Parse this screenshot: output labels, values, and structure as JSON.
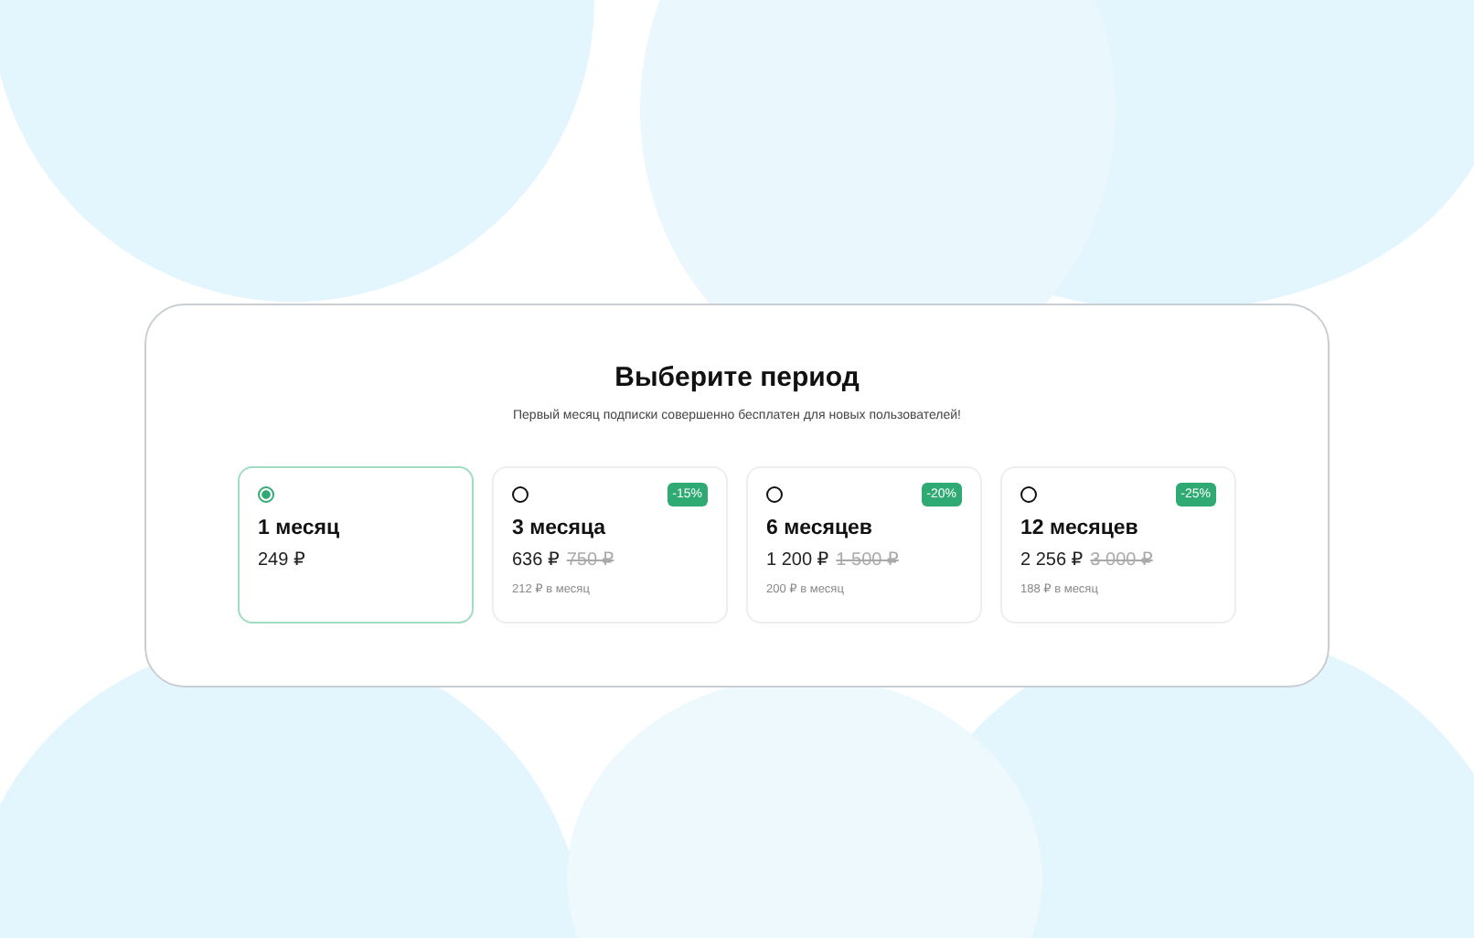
{
  "title": "Выберите период",
  "subtitle": "Первый месяц подписки совершенно бесплатен для новых пользователей!",
  "plans": [
    {
      "name": "1 месяц",
      "price": "249 ₽",
      "selected": true
    },
    {
      "name": "3 месяца",
      "price": "636 ₽",
      "old_price": "750 ₽",
      "per_month": "212 ₽ в месяц",
      "discount": "-15%",
      "selected": false
    },
    {
      "name": "6 месяцев",
      "price": "1 200 ₽",
      "old_price": "1 500 ₽",
      "per_month": "200 ₽ в месяц",
      "discount": "-20%",
      "selected": false
    },
    {
      "name": "12 месяцев",
      "price": "2 256 ₽",
      "old_price": "3 000 ₽",
      "per_month": "188 ₽ в месяц",
      "discount": "-25%",
      "selected": false
    }
  ]
}
